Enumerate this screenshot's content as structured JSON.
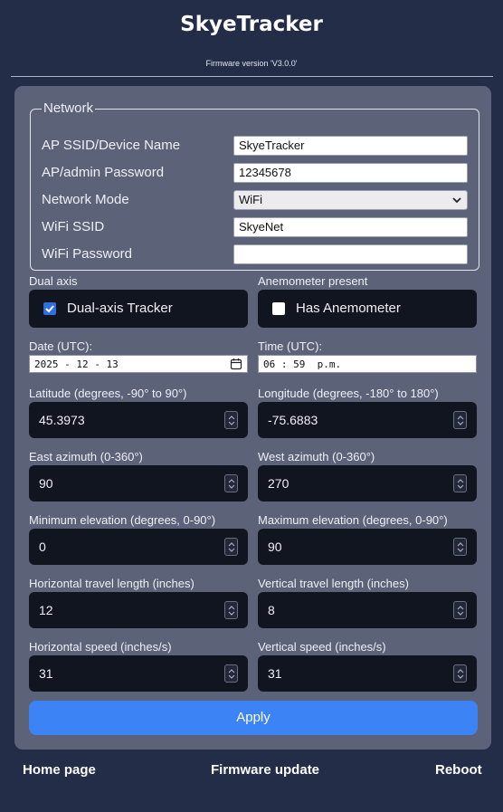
{
  "header": {
    "title": "SkyeTracker",
    "firmware": "Firmware version 'V3.0.0'"
  },
  "network": {
    "legend": "Network",
    "fields": [
      {
        "label": "AP SSID/Device Name",
        "value": "SkyeTracker"
      },
      {
        "label": "AP/admin Password",
        "value": "12345678"
      },
      {
        "label": "Network Mode",
        "value": "WiFi"
      },
      {
        "label": "WiFi SSID",
        "value": "SkyeNet"
      },
      {
        "label": "WiFi Password",
        "value": ""
      }
    ]
  },
  "options": {
    "dual_axis": {
      "heading": "Dual axis",
      "label": "Dual-axis Tracker",
      "checked": true
    },
    "anemometer": {
      "heading": "Anemometer present",
      "label": "Has Anemometer",
      "checked": false
    }
  },
  "datetime": {
    "date_label": "Date (UTC):",
    "date_value": "2025 - 12 - 13",
    "time_label": "Time (UTC):",
    "time_value": "06 : 59  p.m."
  },
  "params": [
    {
      "label": "Latitude (degrees, -90° to 90°)",
      "value": "45.3973"
    },
    {
      "label": "Longitude (degrees, -180° to 180°)",
      "value": "-75.6883"
    },
    {
      "label": "East azimuth (0-360°)",
      "value": "90"
    },
    {
      "label": "West azimuth (0-360°)",
      "value": "270"
    },
    {
      "label": "Minimum elevation (degrees, 0-90°)",
      "value": "0"
    },
    {
      "label": "Maximum elevation (degrees, 0-90°)",
      "value": "90"
    },
    {
      "label": "Horizontal travel length (inches)",
      "value": "12"
    },
    {
      "label": "Vertical travel length (inches)",
      "value": "8"
    },
    {
      "label": "Horizontal speed (inches/s)",
      "value": "31"
    },
    {
      "label": "Vertical speed (inches/s)",
      "value": "31"
    }
  ],
  "apply_label": "Apply",
  "footer": {
    "home": "Home page",
    "firmware_update": "Firmware update",
    "reboot": "Reboot"
  },
  "colors": {
    "background": "#232d48",
    "panel": "#5c6278",
    "input_dark": "#111520",
    "accent": "#3c84f6"
  },
  "icons": [
    "check-icon",
    "chevron-down-icon",
    "calendar-icon",
    "spinner-icon"
  ]
}
